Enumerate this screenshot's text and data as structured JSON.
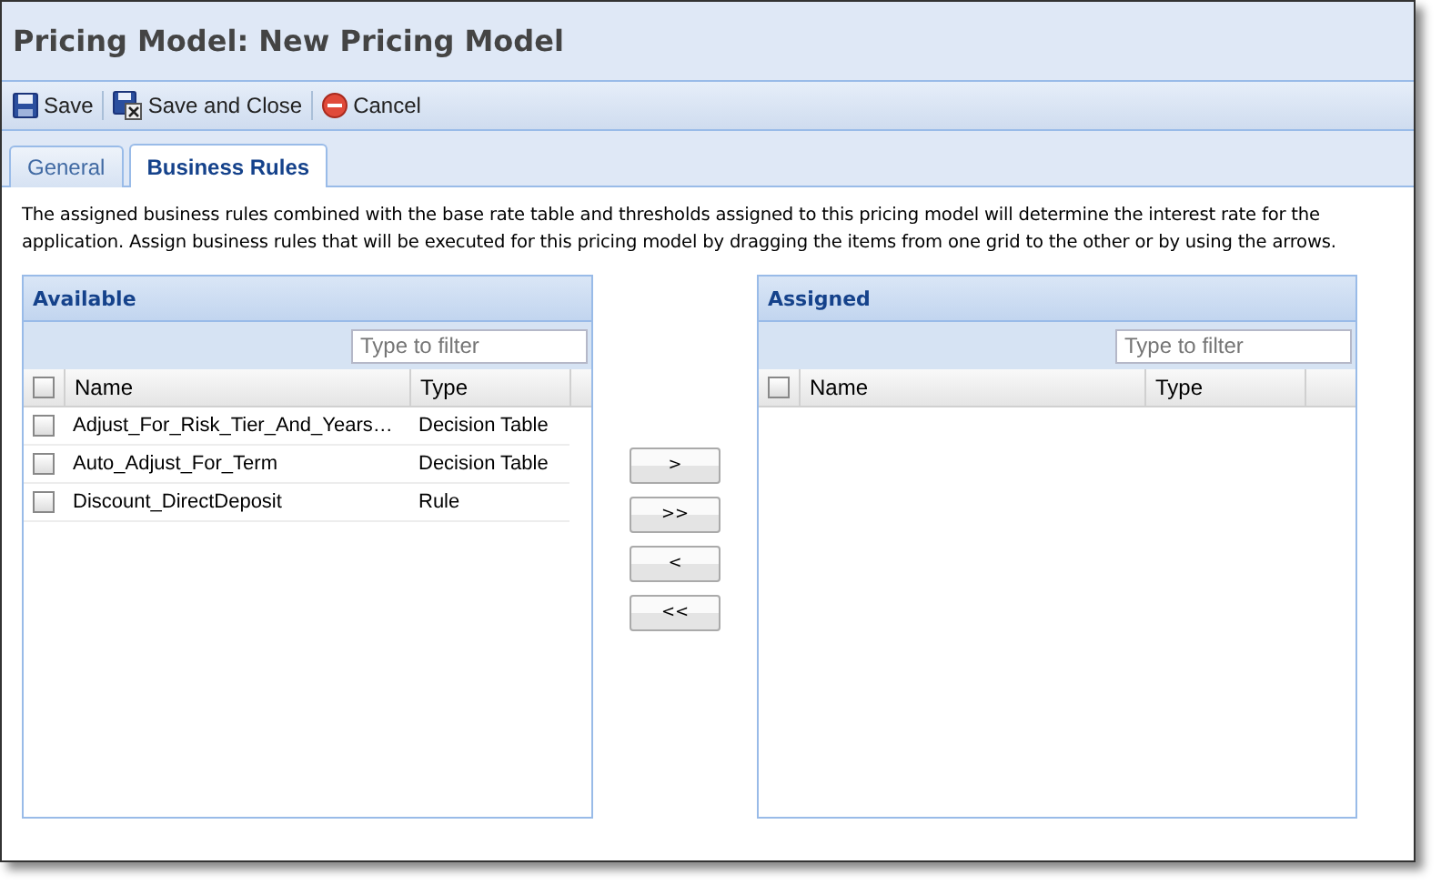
{
  "window": {
    "title": "Pricing Model: New Pricing Model"
  },
  "toolbar": [
    {
      "kind": "save",
      "label": "Save"
    },
    {
      "kind": "save_close",
      "label": "Save and Close"
    },
    {
      "kind": "cancel",
      "label": "Cancel"
    }
  ],
  "tabs": [
    {
      "label": "General",
      "selected": false
    },
    {
      "label": "Business Rules",
      "selected": true
    }
  ],
  "description": "The assigned business rules combined with the base rate table and thresholds assigned to this pricing model will determine the interest rate for the application. Assign business rules that will be executed for this pricing model by dragging the items from one grid to the other or by using the arrows.",
  "available": {
    "title": "Available",
    "filter": {
      "placeholder": "Type to filter"
    },
    "select_all": {
      "checked": false
    },
    "columns": [
      "Name",
      "Type"
    ],
    "rows": [
      {
        "name": "Adjust_For_Risk_Tier_And_Years…",
        "type": "Decision Table",
        "checked": false
      },
      {
        "name": "Auto_Adjust_For_Term",
        "type": "Decision Table",
        "checked": false
      },
      {
        "name": "Discount_DirectDeposit",
        "type": "Rule",
        "checked": false
      }
    ]
  },
  "move_buttons": [
    ">",
    ">>",
    "<",
    "<<"
  ],
  "assigned": {
    "title": "Assigned",
    "filter": {
      "placeholder": "Type to filter"
    },
    "select_all": {
      "checked": false
    },
    "columns": [
      "Name",
      "Type"
    ]
  }
}
